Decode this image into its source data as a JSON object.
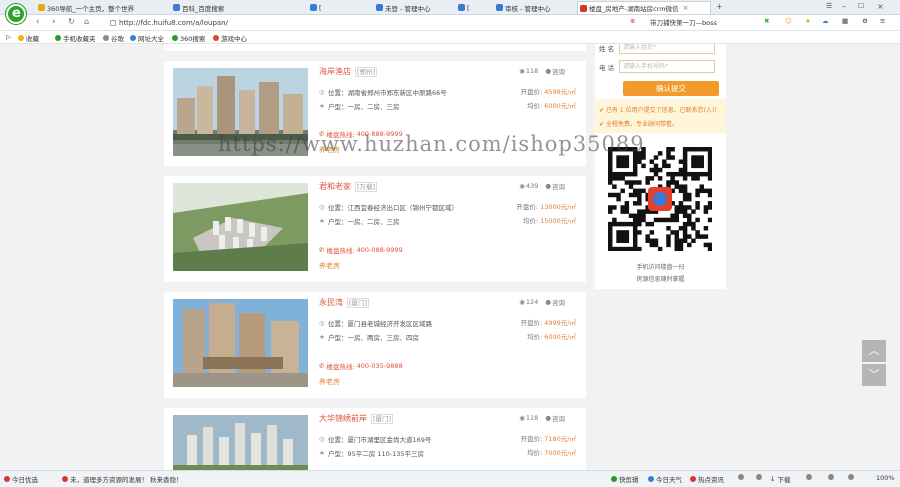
{
  "browser": {
    "tabs": [
      {
        "label": "360导航_一个主页，整个世界",
        "color": "#e6a817"
      },
      {
        "label": "百科_百度搜索",
        "color": "#3b7bd6"
      },
      {
        "label": "[",
        "color": "#3b7bd6"
      },
      {
        "label": "未登 - 管理中心",
        "color": "#3b7bd6"
      },
      {
        "label": "[",
        "color": "#3b7bd6"
      },
      {
        "label": "审核 - 管理中心",
        "color": "#3b7bd6"
      },
      {
        "label": "楼盘_房地产-湖南站房crm微信",
        "color": "#d9342b"
      }
    ],
    "new_tab": "+",
    "url": "http://fdc.huifu8.com/a/loupan/",
    "search_hint": "带刀捕快第一刀—boss",
    "bookmarks": [
      "收藏",
      "手机收藏夹",
      "谷歌",
      "网址大全",
      "360搜索",
      "游戏中心"
    ]
  },
  "listings": [
    {
      "name": "海岸渔店",
      "tag": "[郑州]",
      "views": "118",
      "consult": "咨询",
      "address": "位置：湖南省郑州市郑东新区中原路66号",
      "type": "户型：一房、二房、三房",
      "open_price_label": "开盘价:",
      "open_price": "4598元/㎡",
      "avg_price_label": "均价:",
      "avg_price": "6000元/㎡",
      "hotline_label": "楼盘热线:",
      "hotline": "400-888-9999",
      "sale_tag": "养老房"
    },
    {
      "name": "君和老家",
      "tag": "[万载]",
      "views": "439",
      "consult": "咨询",
      "address": "位置：江西宜春经济出口区（锦州宁都区域）",
      "type": "户型：一房、二房、三房",
      "open_price_label": "开盘价:",
      "open_price": "13000元/㎡",
      "avg_price_label": "均价:",
      "avg_price": "15000元/㎡",
      "hotline_label": "楼盘热线:",
      "hotline": "400-088-9999",
      "sale_tag": "养老房"
    },
    {
      "name": "永民湾",
      "tag": "[厦门]",
      "views": "124",
      "consult": "咨询",
      "address": "位置：厦门县老城经济开发区区域路",
      "type": "户型：一房、两房、三房、四房",
      "open_price_label": "开盘价:",
      "open_price": "4999元/㎡",
      "avg_price_label": "均价:",
      "avg_price": "6000元/㎡",
      "hotline_label": "楼盘热线:",
      "hotline": "400-035-9888",
      "sale_tag": "养老房"
    },
    {
      "name": "大华锦绣前岸",
      "tag": "[厦门]",
      "views": "118",
      "consult": "咨询",
      "address": "位置：厦门市湖里区金尚大道169号",
      "type": "户型：95平二房 110-135平三房",
      "open_price_label": "开盘价:",
      "open_price": "7180元/㎡",
      "avg_price_label": "均价:",
      "avg_price": "7000元/㎡"
    }
  ],
  "side": {
    "name_label": "姓 名",
    "name_placeholder": "请输入姓名*",
    "phone_label": "电 话",
    "phone_placeholder": "请输入手机号码*",
    "submit": "确认提交",
    "notices": [
      "已有 1 位用户提交了信息、已联系您(入)！",
      "全程免费，专业顾问带看。"
    ],
    "qr_caption_1": "手机访问楼盘一扫",
    "qr_caption_2": "房源信息随时掌握"
  },
  "scroll": {
    "up": "︿",
    "down": "﹀"
  },
  "status": {
    "left_1": "今日优选",
    "left_2": "未，道理多方资源的发展！ 秋来香隐！",
    "items": [
      "快剪辑",
      "今日天气",
      "热点资讯",
      "",
      "",
      "下载",
      "",
      "",
      "100%"
    ]
  },
  "watermark": "https://www.huzhan.com/ishop35089"
}
